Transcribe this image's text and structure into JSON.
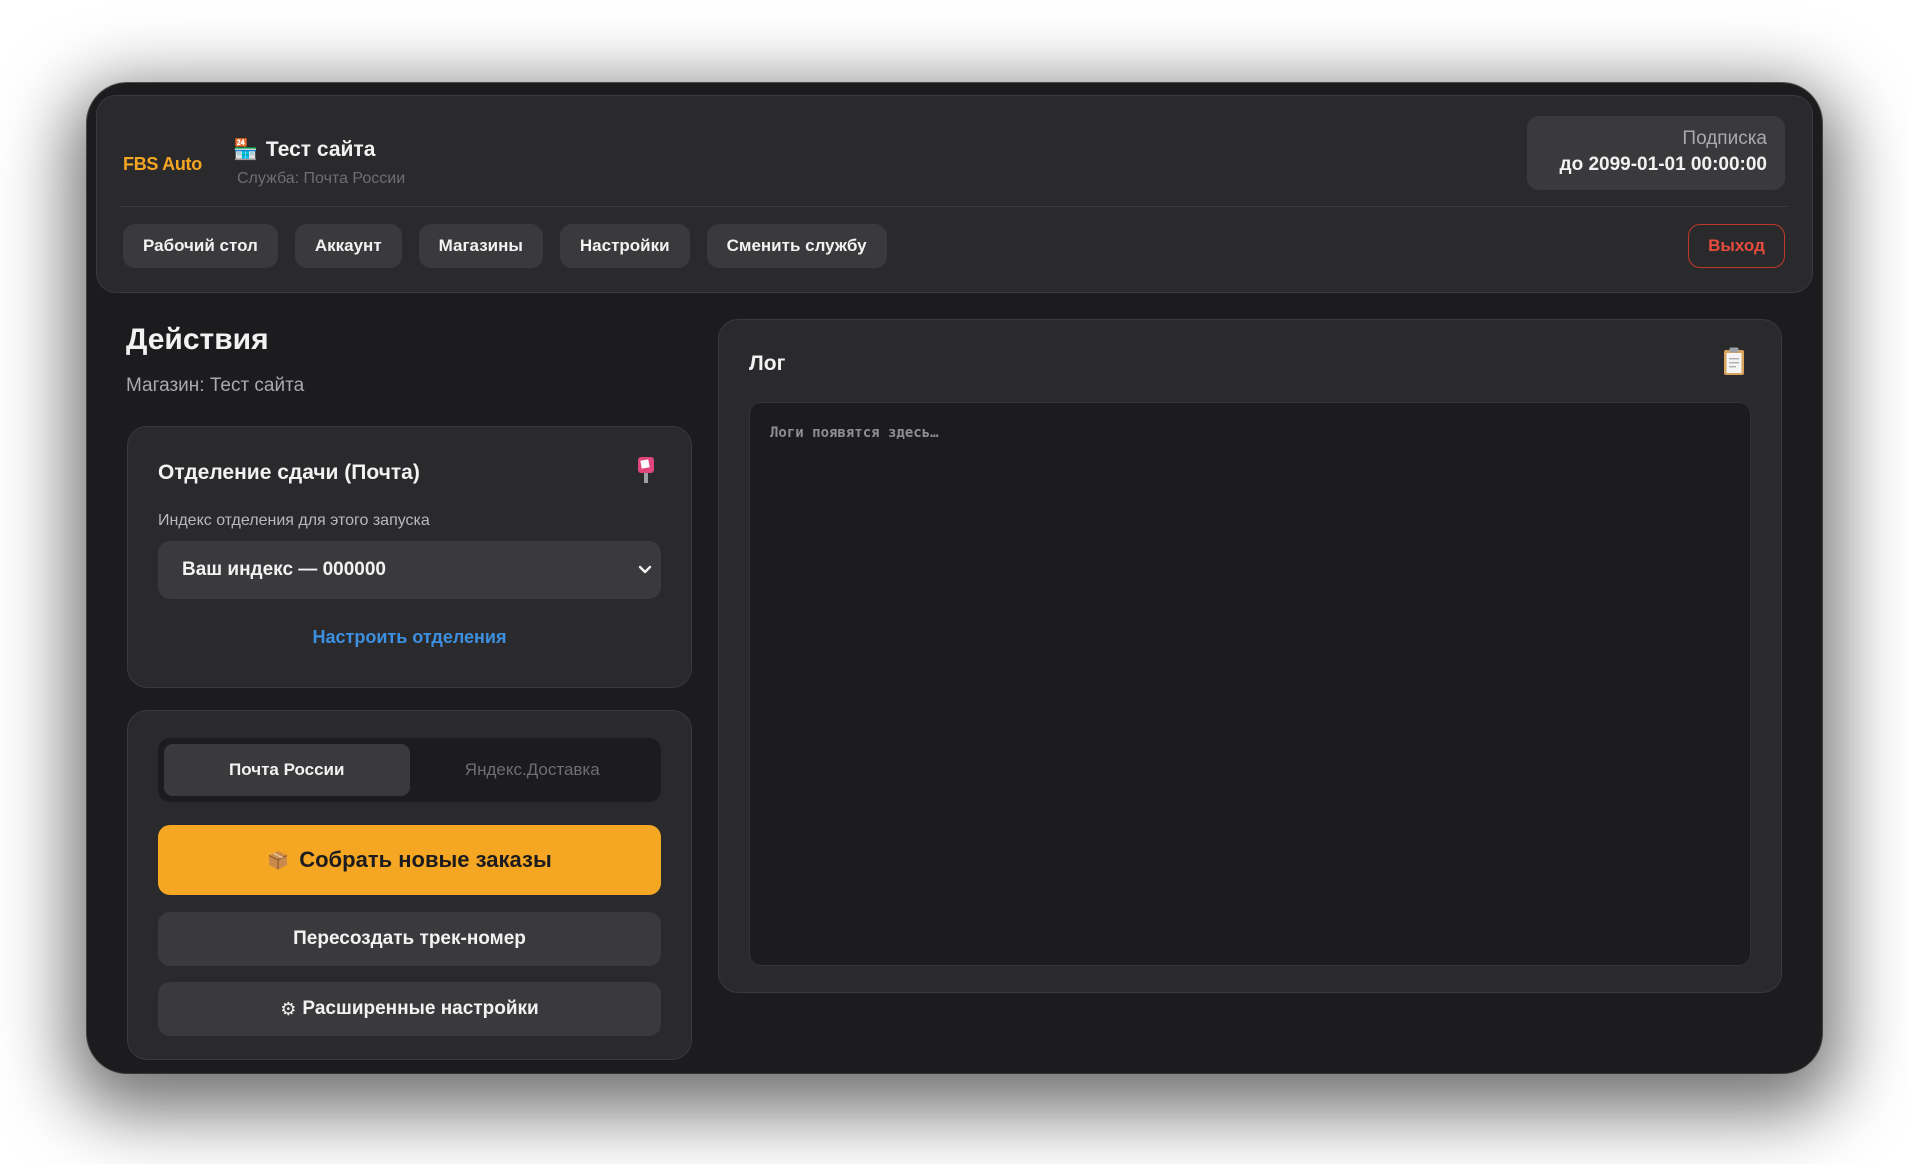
{
  "app": {
    "brand": "FBS Auto"
  },
  "header": {
    "shop_emoji": "🏪",
    "shop_name": "Тест сайта",
    "service": "Служба: Почта России",
    "subscription_label": "Подписка",
    "subscription_value": "до 2099-01-01 00:00:00"
  },
  "nav": {
    "items": [
      {
        "label": "Рабочий стол"
      },
      {
        "label": "Аккаунт"
      },
      {
        "label": "Магазины"
      },
      {
        "label": "Настройки"
      },
      {
        "label": "Сменить службу"
      }
    ],
    "logout": "Выход"
  },
  "actions": {
    "title": "Действия",
    "shop_line": "Магазин: Тест сайта"
  },
  "office_card": {
    "title": "Отделение сдачи (Почта)",
    "icon": "postbox-icon",
    "field_label": "Индекс отделения для этого запуска",
    "selected": "Ваш индекс — 000000",
    "configure_link": "Настроить отделения"
  },
  "run_card": {
    "tabs": [
      {
        "label": "Почта России",
        "active": true
      },
      {
        "label": "Яндекс.Доставка",
        "active": false
      }
    ],
    "primary_button": "Собрать новые заказы",
    "retrack_button": "Пересоздать трек-номер",
    "advanced_button": "Расширенные настройки"
  },
  "log": {
    "title": "Лог",
    "icon": "clipboard-icon",
    "placeholder": "Логи появятся здесь…"
  },
  "colors": {
    "accent": "#f5a623",
    "link": "#3d8fe0",
    "danger": "#e74c3c",
    "background": "#1c1c1e",
    "card": "#2a2a2d"
  }
}
